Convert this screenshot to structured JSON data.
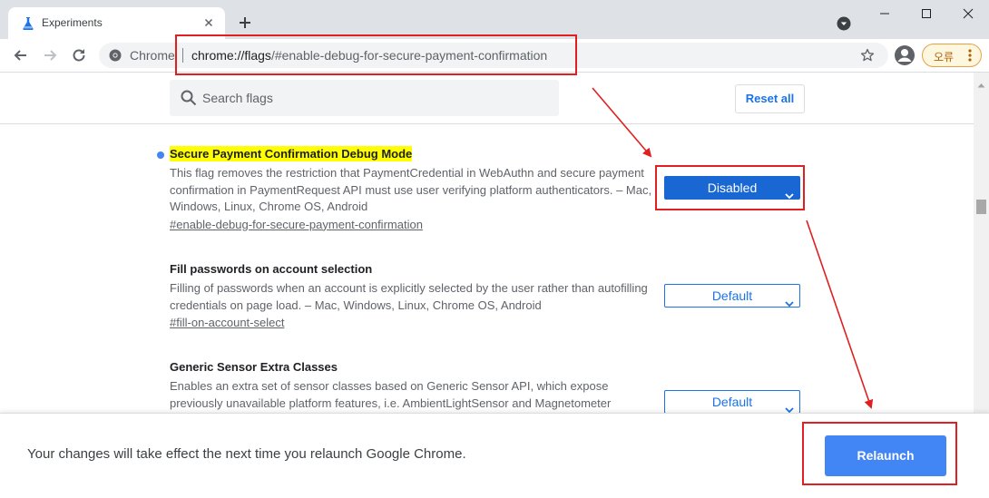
{
  "browser": {
    "tab_title": "Experiments",
    "omnibox_chip": "Chrome",
    "url_host": "chrome://flags",
    "url_path": "/#enable-debug-for-secure-payment-confirmation",
    "error_chip_label": "오류"
  },
  "flags_page": {
    "search_placeholder": "Search flags",
    "reset_all_label": "Reset all",
    "flags": [
      {
        "title": "Secure Payment Confirmation Debug Mode",
        "description": "This flag removes the restriction that PaymentCredential in WebAuthn and secure payment confirmation in PaymentRequest API must use user verifying platform authenticators. – Mac, Windows, Linux, Chrome OS, Android",
        "link": "#enable-debug-for-secure-payment-confirmation",
        "value": "Disabled",
        "modified": true
      },
      {
        "title": "Fill passwords on account selection",
        "description": "Filling of passwords when an account is explicitly selected by the user rather than autofilling credentials on page load. – Mac, Windows, Linux, Chrome OS, Android",
        "link": "#fill-on-account-select",
        "value": "Default",
        "modified": false
      },
      {
        "title": "Generic Sensor Extra Classes",
        "description": "Enables an extra set of sensor classes based on Generic Sensor API, which expose previously unavailable platform features, i.e. AmbientLightSensor and Magnetometer",
        "value": "Default",
        "modified": false
      }
    ]
  },
  "relaunch": {
    "message": "Your changes will take effect the next time you relaunch Google Chrome.",
    "button_label": "Relaunch"
  },
  "colors": {
    "accent": "#1a73e8",
    "relaunch_button": "#4285f4",
    "annotation": "#e02020",
    "highlight": "#ffff00"
  }
}
